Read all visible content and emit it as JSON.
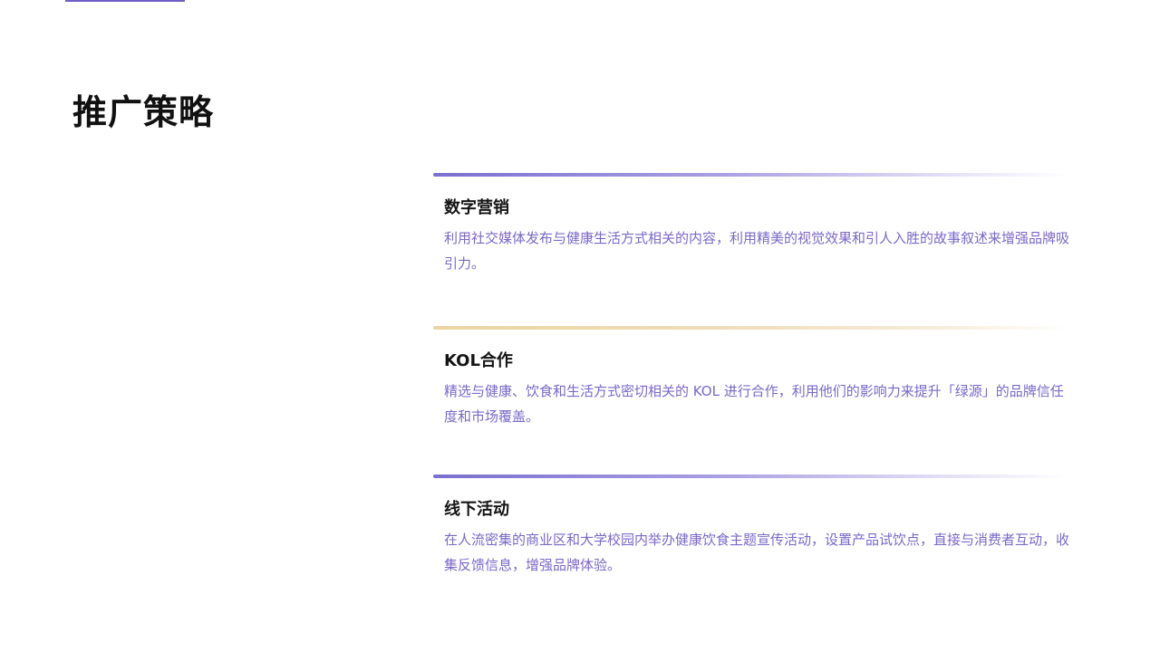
{
  "page": {
    "title": "推广策略"
  },
  "strategies": [
    {
      "title": "数字营销",
      "description": "利用社交媒体发布与健康生活方式相关的内容，利用精美的视觉效果和引人入胜的故事叙述来增强品牌吸引力。"
    },
    {
      "title": "KOL合作",
      "description": "精选与健康、饮食和生活方式密切相关的 KOL 进行合作，利用他们的影响力来提升「绿源」的品牌信任度和市场覆盖。"
    },
    {
      "title": "线下活动",
      "description": "在人流密集的商业区和大学校园内举办健康饮食主题宣传活动，设置产品试饮点，直接与消费者互动，收集反馈信息，增强品牌体验。"
    }
  ],
  "colors": {
    "accent_purple": "#7b6fd0",
    "accent_gold": "#ecd3a3",
    "description_text": "#7a68c9",
    "heading_text": "#141414"
  }
}
